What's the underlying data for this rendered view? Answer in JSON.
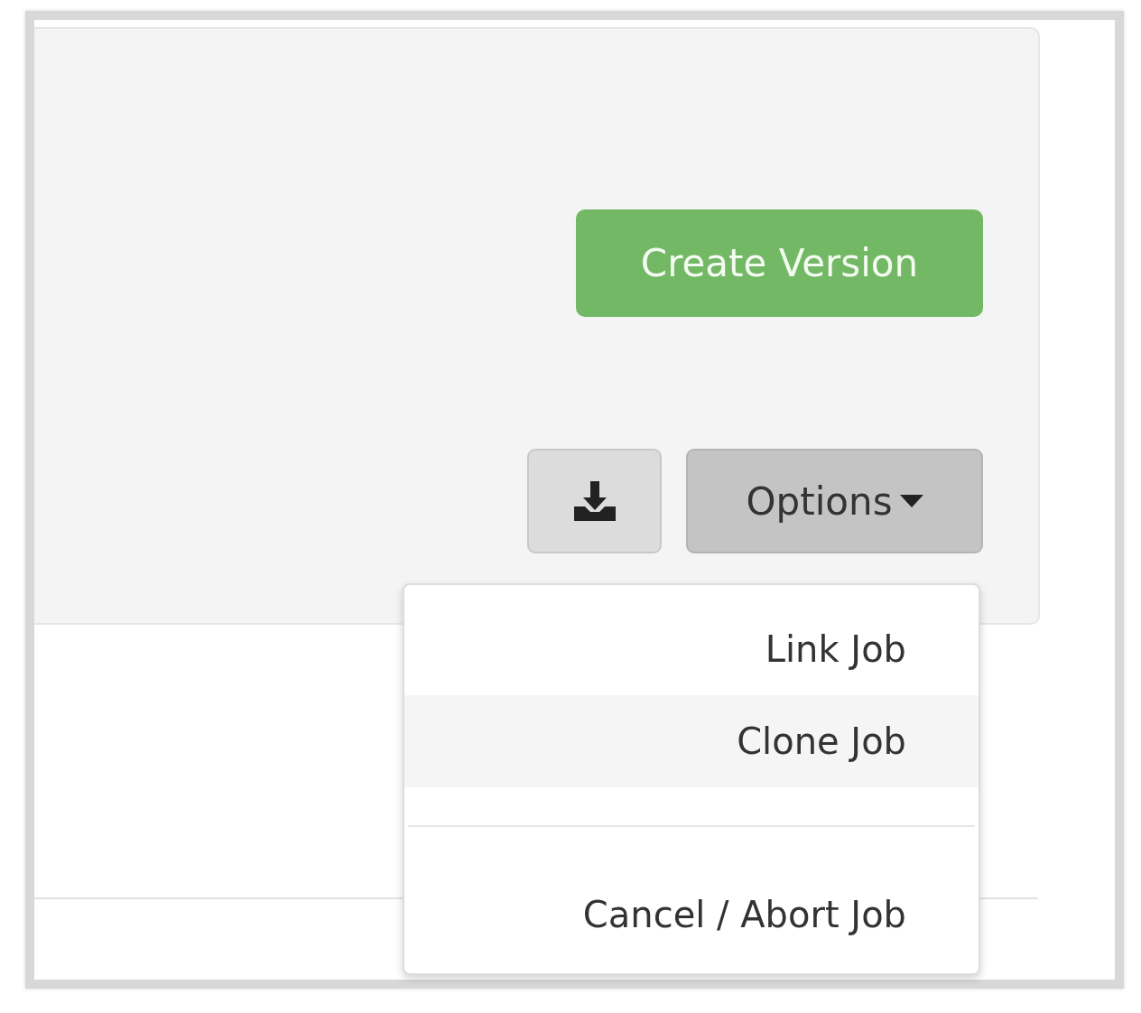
{
  "actions": {
    "create_version": "Create Version",
    "options": {
      "label": "Options",
      "expanded": true
    }
  },
  "options_menu": [
    {
      "kind": "item",
      "label": "Link Job",
      "selected": false
    },
    {
      "kind": "item",
      "label": "Clone Job",
      "selected": true
    },
    {
      "kind": "divider"
    },
    {
      "kind": "item",
      "label": "Cancel / Abort Job",
      "selected": false
    }
  ]
}
